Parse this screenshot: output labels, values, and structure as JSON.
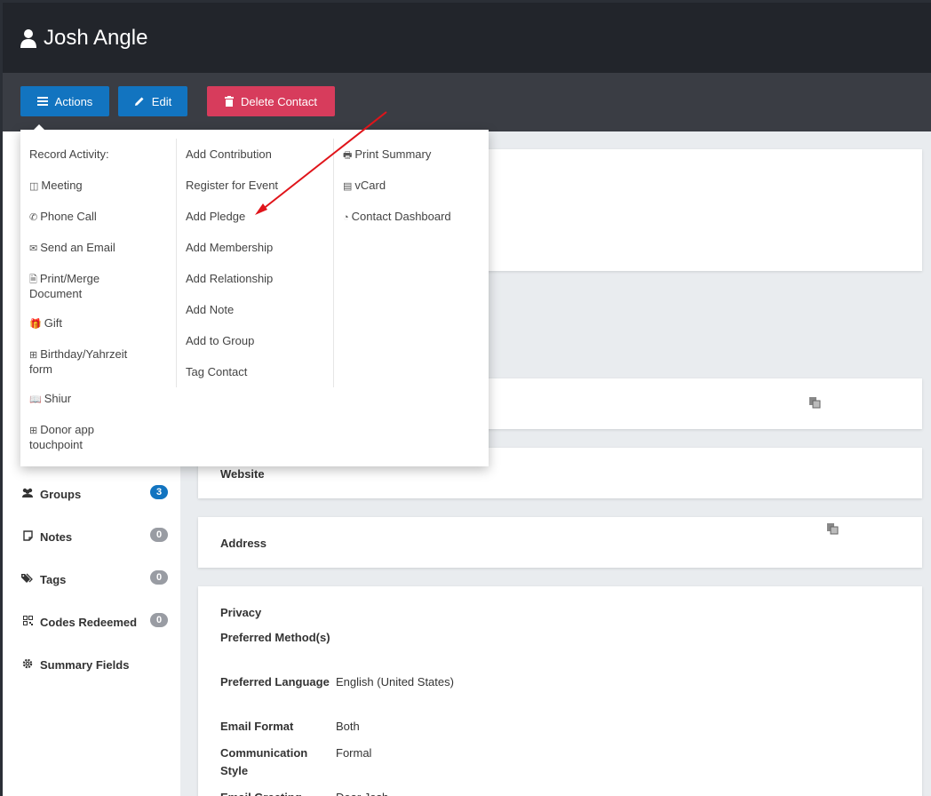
{
  "header": {
    "contact_name": "Josh Angle"
  },
  "toolbar": {
    "actions_label": "Actions",
    "edit_label": "Edit",
    "delete_label": "Delete Contact"
  },
  "actions_menu": {
    "record_activity_label": "Record Activity:",
    "col1": [
      {
        "label": "Meeting",
        "icon": "meeting-icon"
      },
      {
        "label": "Phone Call",
        "icon": "phone-icon"
      },
      {
        "label": "Send an Email",
        "icon": "envelope-icon"
      },
      {
        "label": "Print/Merge Document",
        "icon": "pdf-icon"
      },
      {
        "label": "Gift",
        "icon": "gift-icon"
      },
      {
        "label": "Birthday/Yahrzeit form",
        "icon": "plus-square-icon"
      },
      {
        "label": "Shiur",
        "icon": "book-icon"
      },
      {
        "label": "Donor app touchpoint",
        "icon": "plus-square-icon"
      }
    ],
    "col2": [
      "Add Contribution",
      "Register for Event",
      "Add Pledge",
      "Add Membership",
      "Add Relationship",
      "Add Note",
      "Add to Group",
      "Tag Contact"
    ],
    "col3": [
      {
        "label": "Print Summary",
        "icon": "printer-icon"
      },
      {
        "label": "vCard",
        "icon": "vcard-icon"
      },
      {
        "label": "Contact Dashboard",
        "icon": "dashboard-icon"
      }
    ]
  },
  "sidebar": {
    "items": [
      {
        "label": "Groups",
        "count": "3",
        "icon": "users-icon",
        "badge_color": "#1274c0"
      },
      {
        "label": "Notes",
        "count": "0",
        "icon": "note-icon",
        "badge_color": "#999ca3"
      },
      {
        "label": "Tags",
        "count": "0",
        "icon": "tags-icon",
        "badge_color": "#999ca3"
      },
      {
        "label": "Codes Redeemed",
        "count": "0",
        "icon": "qrcode-icon",
        "badge_color": "#999ca3"
      },
      {
        "label": "Summary Fields",
        "icon": "gear-icon"
      }
    ]
  },
  "main": {
    "website_label": "Website",
    "address_label": "Address",
    "privacy": {
      "privacy_label": "Privacy",
      "rows": [
        {
          "key": "Preferred Method(s)",
          "value": ""
        },
        {
          "key": "Preferred Language",
          "value": "English (United States)"
        },
        {
          "key": "Email Format",
          "value": "Both"
        },
        {
          "key": "Communication Style",
          "value": "Formal"
        },
        {
          "key": "Email Greeting",
          "value": "Dear Josh"
        }
      ]
    }
  },
  "colors": {
    "topbar": "#22252b",
    "toolbar": "#3a3d44",
    "primary": "#1274c0",
    "danger": "#d73c5c",
    "annotation_arrow": "#e0141a"
  }
}
